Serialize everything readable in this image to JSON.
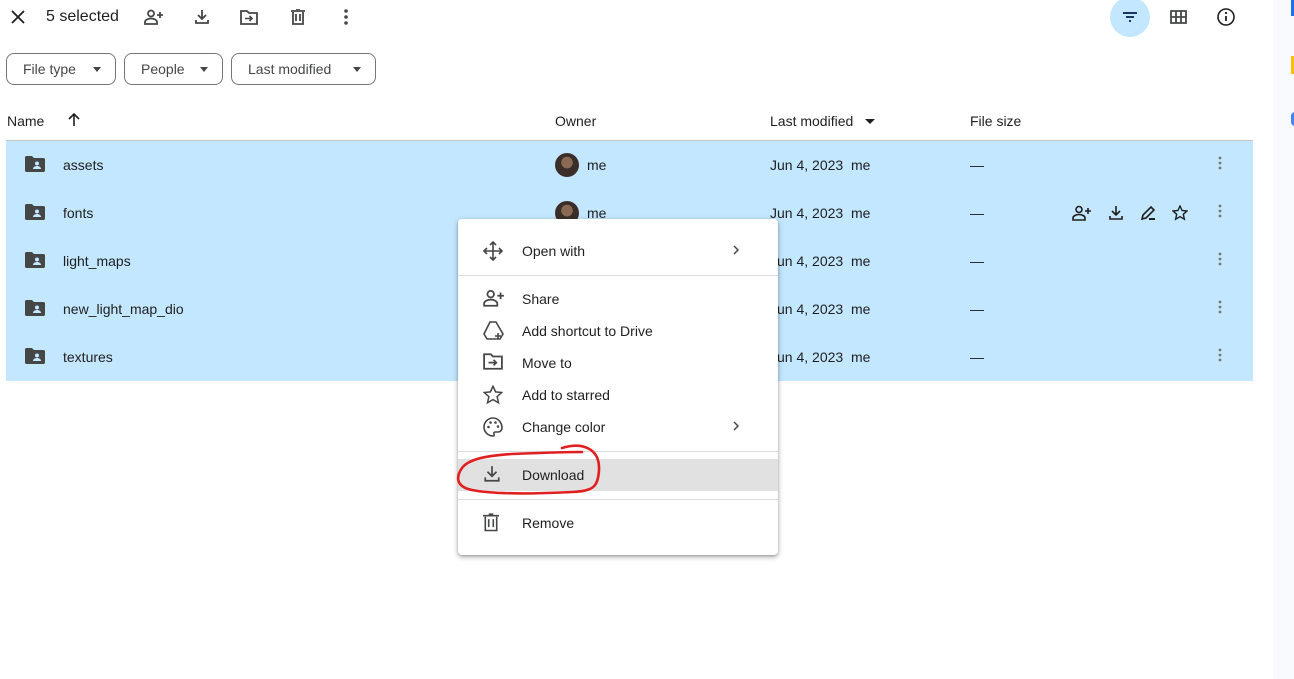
{
  "toolbar": {
    "selected_label": "5 selected"
  },
  "filters": [
    {
      "label": "File type"
    },
    {
      "label": "People"
    },
    {
      "label": "Last modified"
    }
  ],
  "columns": {
    "name": "Name",
    "owner": "Owner",
    "last_modified": "Last modified",
    "file_size": "File size"
  },
  "rows": [
    {
      "name": "assets",
      "owner": "me",
      "modified": "Jun 4, 2023",
      "modified_by": "me",
      "size": "—"
    },
    {
      "name": "fonts",
      "owner": "me",
      "modified": "Jun 4, 2023",
      "modified_by": "me",
      "size": "—"
    },
    {
      "name": "light_maps",
      "owner": "me",
      "modified": "Jun 4, 2023",
      "modified_by": "me",
      "size": "—"
    },
    {
      "name": "new_light_map_dio",
      "owner": "me",
      "modified": "Jun 4, 2023",
      "modified_by": "me",
      "size": "—"
    },
    {
      "name": "textures",
      "owner": "me",
      "modified": "Jun 4, 2023",
      "modified_by": "me",
      "size": "—"
    }
  ],
  "context_menu": {
    "items": [
      {
        "label": "Open with",
        "icon": "open-with-icon"
      },
      {
        "label": "Share",
        "icon": "person-add-icon"
      },
      {
        "label": "Add shortcut to Drive",
        "icon": "drive-shortcut-icon"
      },
      {
        "label": "Move to",
        "icon": "move-icon"
      },
      {
        "label": "Add to starred",
        "icon": "star-icon"
      },
      {
        "label": "Change color",
        "icon": "palette-icon"
      },
      {
        "label": "Download",
        "icon": "download-icon"
      },
      {
        "label": "Remove",
        "icon": "trash-icon"
      }
    ]
  },
  "colors": {
    "selection": "#c2e7ff",
    "annotation": "#e02020"
  }
}
